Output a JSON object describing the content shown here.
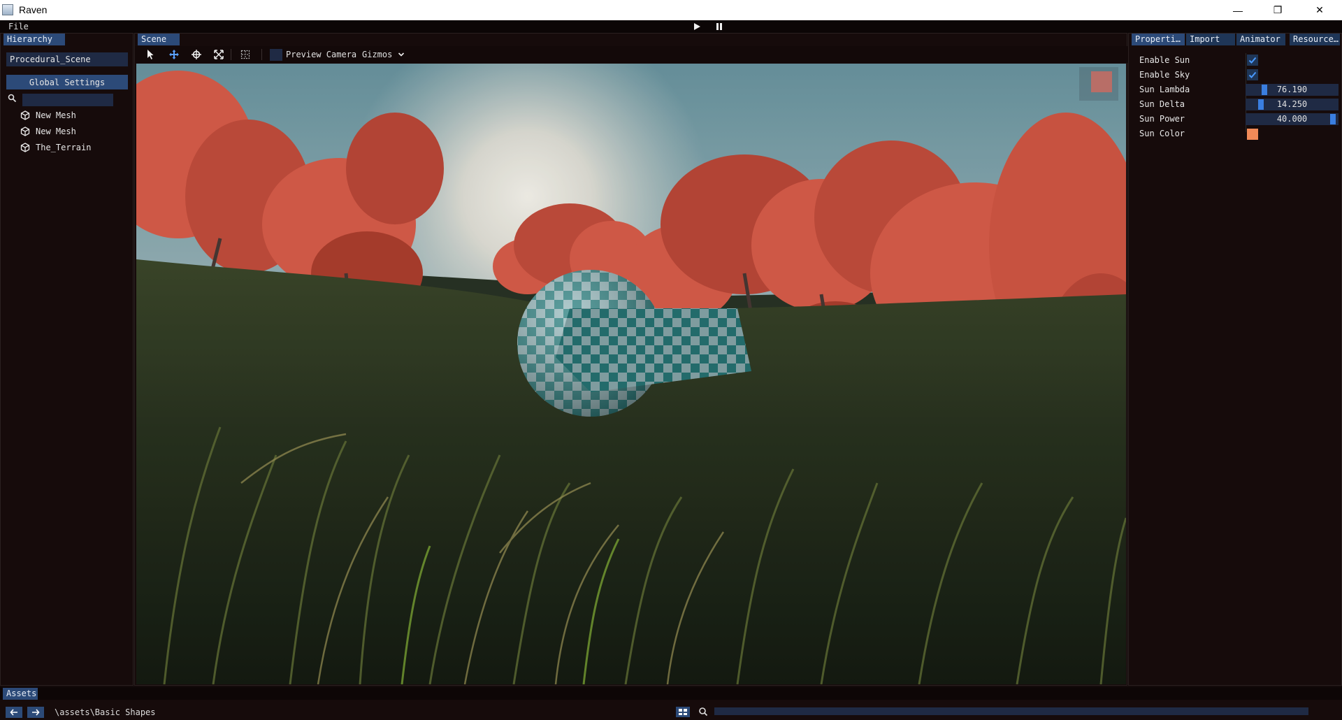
{
  "window": {
    "title": "Raven",
    "minimize_glyph": "—",
    "restore_glyph": "❐",
    "close_glyph": "✕"
  },
  "menu": {
    "file": "File",
    "play_icon": "play-icon",
    "pause_icon": "pause-icon"
  },
  "hierarchy": {
    "tab": "Hierarchy",
    "scene_name": "Procedural_Scene",
    "global_settings": "Global Settings",
    "search_placeholder": "",
    "items": [
      {
        "label": "New Mesh",
        "icon": "cube-icon"
      },
      {
        "label": "New Mesh",
        "icon": "cube-icon"
      },
      {
        "label": "The_Terrain",
        "icon": "cube-icon"
      }
    ]
  },
  "scene": {
    "tab": "Scene",
    "tools": [
      "select-icon",
      "move-icon",
      "rotate-icon",
      "scale-icon",
      "grid-icon"
    ],
    "preview_camera": "Preview Camera",
    "gizmos": "Gizmos"
  },
  "properties": {
    "tabs": [
      "Properti…",
      "Import",
      "Animator",
      "Resource…"
    ],
    "rows": [
      {
        "label": "Enable Sun",
        "type": "checkbox",
        "checked": true
      },
      {
        "label": "Enable Sky",
        "type": "checkbox",
        "checked": true
      },
      {
        "label": "Sun Lambda",
        "type": "slider",
        "value": "76.190",
        "fraction": 0.18
      },
      {
        "label": "Sun Delta",
        "type": "slider",
        "value": "14.250",
        "fraction": 0.14
      },
      {
        "label": "Sun Power",
        "type": "slider",
        "value": "40.000",
        "fraction": 0.97
      },
      {
        "label": "Sun Color",
        "type": "color",
        "color": "#f08a58"
      }
    ]
  },
  "assets": {
    "tab": "Assets",
    "path": "\\assets\\Basic Shapes"
  },
  "colors": {
    "accent": "#2c4a78",
    "accent_inactive": "#1f3657",
    "slider_grab": "#3a7ee0",
    "background": "#160b0b"
  }
}
